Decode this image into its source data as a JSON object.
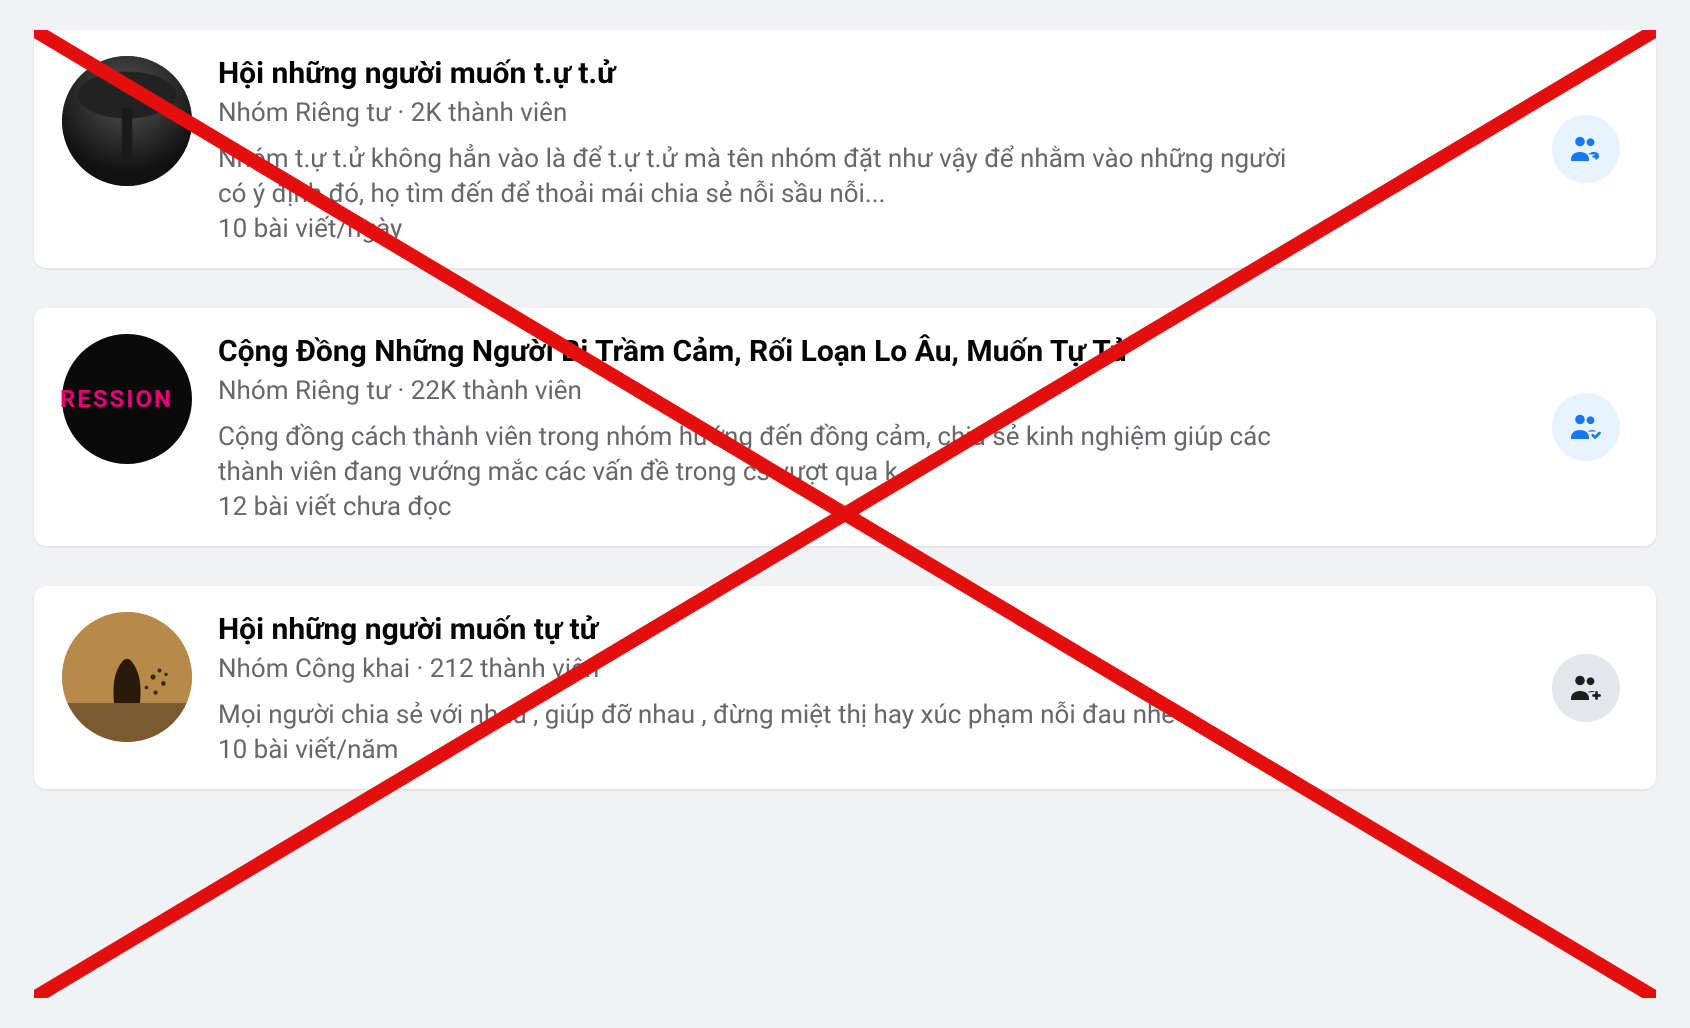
{
  "groups": [
    {
      "title": "Hội những người muốn t.ự t.ử",
      "meta": "Nhóm Riêng tư · 2K thành viên",
      "desc": "Nhóm t.ự t.ử không hẳn vào là để t.ự t.ử mà tên nhóm đặt như vậy để nhằm vào những người có ý định đó, họ tìm đến để thoải mái chia sẻ nỗi sầu nỗi...",
      "posts": "10 bài viết/ngày",
      "action": "join-arrow",
      "avatar_label": ""
    },
    {
      "title": "Cộng Đồng Những Người Bị Trầm Cảm, Rối Loạn Lo Âu, Muốn Tự Tử",
      "meta": "Nhóm Riêng tư · 22K thành viên",
      "desc": "Cộng đồng cách thành viên trong nhóm hướng đến đồng cảm, chia sẻ kinh nghiệm giúp các thành viên đang vướng mắc các vấn đề trong cs vượt qua k...",
      "posts": "12 bài viết chưa đọc",
      "action": "joined-check",
      "avatar_label": "RESSION"
    },
    {
      "title": "Hội những người muốn tự tử",
      "meta": "Nhóm Công khai · 212 thành viên",
      "desc": "Mọi người chia sẻ với nhau , giúp đỡ nhau , đừng miệt thị hay xúc phạm nỗi đau nhé",
      "posts": "10 bài viết/năm",
      "action": "join-plus",
      "avatar_label": ""
    }
  ],
  "overlay": {
    "stroke": "#e30e0e",
    "width": 14
  }
}
